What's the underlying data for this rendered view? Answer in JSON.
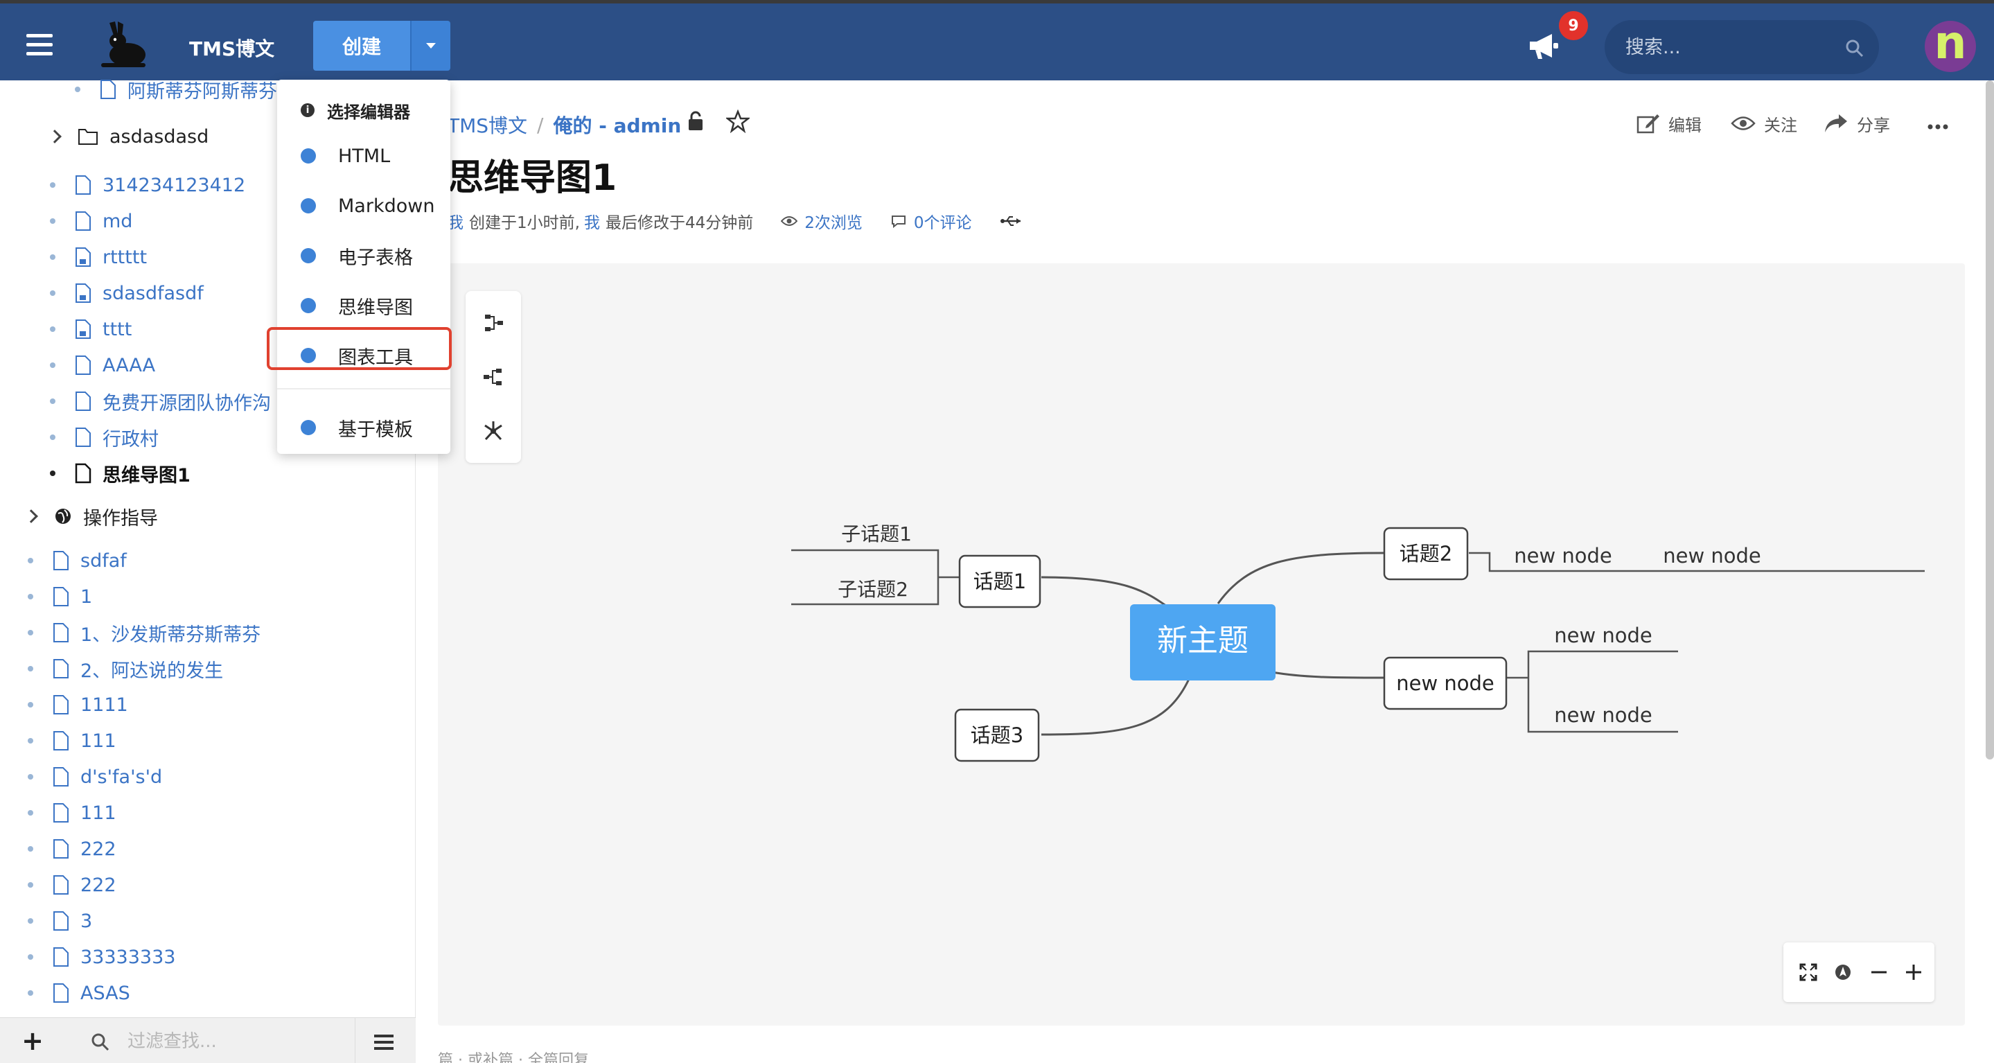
{
  "topbar": {
    "brand": "TMS博文",
    "create_label": "创建",
    "notification_count": "9",
    "search_placeholder": "搜索...",
    "avatar_letter": "n"
  },
  "dropdown": {
    "header": "选择编辑器",
    "items": [
      "HTML",
      "Markdown",
      "电子表格",
      "思维导图",
      "图表工具",
      "基于模板"
    ],
    "highlighted": "图表工具"
  },
  "sidebar": {
    "items": [
      {
        "label": "阿斯蒂芬阿斯蒂芬"
      },
      {
        "label": "asdasdasd"
      },
      {
        "label": "314234123412"
      },
      {
        "label": "md"
      },
      {
        "label": "rttttt"
      },
      {
        "label": "sdasdfasdf"
      },
      {
        "label": "tttt"
      },
      {
        "label": "AAAA"
      },
      {
        "label": "免费开源团队协作沟"
      },
      {
        "label": "行政村"
      },
      {
        "label": "思维导图1"
      },
      {
        "label": "操作指导"
      },
      {
        "label": "sdfaf"
      },
      {
        "label": "1"
      },
      {
        "label": "1、沙发斯蒂芬斯蒂芬"
      },
      {
        "label": "2、阿达说的发生"
      },
      {
        "label": "1111"
      },
      {
        "label": "111"
      },
      {
        "label": "d's'fa's'd"
      },
      {
        "label": "111"
      },
      {
        "label": "222"
      },
      {
        "label": "222"
      },
      {
        "label": "3"
      },
      {
        "label": "33333333"
      },
      {
        "label": "ASAS"
      }
    ],
    "filter_placeholder": "过滤查找..."
  },
  "page": {
    "breadcrumb_space": "TMS博文",
    "breadcrumb_sep": "/",
    "breadcrumb_current": "俺的 - admin",
    "title": "思维导图1",
    "meta_me1": "我",
    "meta_created": "创建于1小时前,",
    "meta_me2": "我",
    "meta_modified": "最后修改于44分钟前",
    "views": "2次浏览",
    "comments": "0个评论",
    "actions": {
      "edit": "编辑",
      "watch": "关注",
      "share": "分享"
    },
    "footer_partial": "篇 · 或补篇 · 全篇回复"
  },
  "mindmap": {
    "root": "新主题",
    "topic1": "话题1",
    "sub1": "子话题1",
    "sub2": "子话题2",
    "topic2": "话题2",
    "t2_child1": "new node",
    "t2_child2": "new node",
    "topic3": "话题3",
    "node4": "new node",
    "n4_child1": "new node",
    "n4_child2": "new node"
  },
  "colors": {
    "topbar": "#2c4f86",
    "primary": "#4a90e2",
    "link": "#3b74c5",
    "highlight_border": "#e0412f",
    "root_node": "#4ea6f2"
  }
}
